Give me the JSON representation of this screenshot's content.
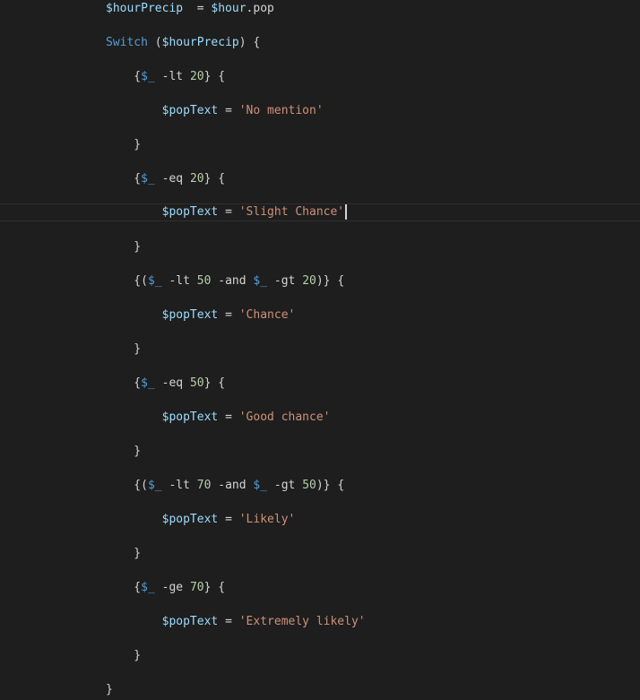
{
  "editor": {
    "lines": [
      {
        "segments": [
          {
            "t": "$hourPrecip",
            "c": "var"
          },
          {
            "t": "  = ",
            "c": "op"
          },
          {
            "t": "$hour",
            "c": "var"
          },
          {
            "t": ".pop",
            "c": "op"
          }
        ]
      },
      {
        "segments": [
          {
            "t": "Switch",
            "c": "kw"
          },
          {
            "t": " (",
            "c": "op"
          },
          {
            "t": "$hourPrecip",
            "c": "var"
          },
          {
            "t": ") {",
            "c": "op"
          }
        ]
      },
      {
        "segments": [
          {
            "t": "    {",
            "c": "op"
          },
          {
            "t": "$_",
            "c": "var2"
          },
          {
            "t": " -lt ",
            "c": "op"
          },
          {
            "t": "20",
            "c": "num"
          },
          {
            "t": "} {",
            "c": "op"
          }
        ]
      },
      {
        "segments": [
          {
            "t": "        ",
            "c": "op"
          },
          {
            "t": "$popText",
            "c": "var"
          },
          {
            "t": " = ",
            "c": "op"
          },
          {
            "t": "'No mention'",
            "c": "str"
          }
        ]
      },
      {
        "segments": [
          {
            "t": "    }",
            "c": "op"
          }
        ]
      },
      {
        "segments": [
          {
            "t": "    {",
            "c": "op"
          },
          {
            "t": "$_",
            "c": "var2"
          },
          {
            "t": " -eq ",
            "c": "op"
          },
          {
            "t": "20",
            "c": "num"
          },
          {
            "t": "} {",
            "c": "op"
          }
        ]
      },
      {
        "segments": [
          {
            "t": "        ",
            "c": "op"
          },
          {
            "t": "$popText",
            "c": "var"
          },
          {
            "t": " = ",
            "c": "op"
          },
          {
            "t": "'Slight Chance'",
            "c": "str"
          }
        ],
        "current": true
      },
      {
        "segments": [
          {
            "t": "    }",
            "c": "op"
          }
        ]
      },
      {
        "segments": [
          {
            "t": "    {(",
            "c": "op"
          },
          {
            "t": "$_",
            "c": "var2"
          },
          {
            "t": " -lt ",
            "c": "op"
          },
          {
            "t": "50",
            "c": "num"
          },
          {
            "t": " -and ",
            "c": "op"
          },
          {
            "t": "$_",
            "c": "var2"
          },
          {
            "t": " -gt ",
            "c": "op"
          },
          {
            "t": "20",
            "c": "num"
          },
          {
            "t": ")} {",
            "c": "op"
          }
        ]
      },
      {
        "segments": [
          {
            "t": "        ",
            "c": "op"
          },
          {
            "t": "$popText",
            "c": "var"
          },
          {
            "t": " = ",
            "c": "op"
          },
          {
            "t": "'Chance'",
            "c": "str"
          }
        ]
      },
      {
        "segments": [
          {
            "t": "    }",
            "c": "op"
          }
        ]
      },
      {
        "segments": [
          {
            "t": "    {",
            "c": "op"
          },
          {
            "t": "$_",
            "c": "var2"
          },
          {
            "t": " -eq ",
            "c": "op"
          },
          {
            "t": "50",
            "c": "num"
          },
          {
            "t": "} {",
            "c": "op"
          }
        ]
      },
      {
        "segments": [
          {
            "t": "        ",
            "c": "op"
          },
          {
            "t": "$popText",
            "c": "var"
          },
          {
            "t": " = ",
            "c": "op"
          },
          {
            "t": "'Good chance'",
            "c": "str"
          }
        ]
      },
      {
        "segments": [
          {
            "t": "    }",
            "c": "op"
          }
        ]
      },
      {
        "segments": [
          {
            "t": "    {(",
            "c": "op"
          },
          {
            "t": "$_",
            "c": "var2"
          },
          {
            "t": " -lt ",
            "c": "op"
          },
          {
            "t": "70",
            "c": "num"
          },
          {
            "t": " -and ",
            "c": "op"
          },
          {
            "t": "$_",
            "c": "var2"
          },
          {
            "t": " -gt ",
            "c": "op"
          },
          {
            "t": "50",
            "c": "num"
          },
          {
            "t": ")} {",
            "c": "op"
          }
        ]
      },
      {
        "segments": [
          {
            "t": "        ",
            "c": "op"
          },
          {
            "t": "$popText",
            "c": "var"
          },
          {
            "t": " = ",
            "c": "op"
          },
          {
            "t": "'Likely'",
            "c": "str"
          }
        ]
      },
      {
        "segments": [
          {
            "t": "    }",
            "c": "op"
          }
        ]
      },
      {
        "segments": [
          {
            "t": "    {",
            "c": "op"
          },
          {
            "t": "$_",
            "c": "var2"
          },
          {
            "t": " -ge ",
            "c": "op"
          },
          {
            "t": "70",
            "c": "num"
          },
          {
            "t": "} {",
            "c": "op"
          }
        ]
      },
      {
        "segments": [
          {
            "t": "        ",
            "c": "op"
          },
          {
            "t": "$popText",
            "c": "var"
          },
          {
            "t": " = ",
            "c": "op"
          },
          {
            "t": "'Extremely likely'",
            "c": "str"
          }
        ]
      },
      {
        "segments": [
          {
            "t": "    }",
            "c": "op"
          }
        ]
      },
      {
        "segments": [
          {
            "t": "}",
            "c": "op"
          }
        ]
      }
    ]
  },
  "colors": {
    "background": "#1e1e1e",
    "variable": "#9cdcfe",
    "automatic_variable": "#569cd6",
    "keyword": "#569cd6",
    "number": "#b5cea8",
    "string": "#ce9178",
    "text": "#d4d4d4"
  }
}
